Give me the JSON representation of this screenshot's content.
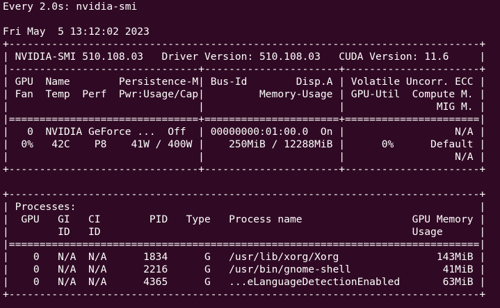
{
  "terminal": {
    "background": "#300a24",
    "foreground": "#ffffff",
    "lines": [
      "Every 2.0s: nvidia-smi",
      "",
      "Fri May  5 13:12:02 2023",
      "+-----------------------------------------------------------------------------+",
      "| NVIDIA-SMI 510.108.03   Driver Version: 510.108.03   CUDA Version: 11.6     |",
      "|-------------------------------+----------------------+----------------------+",
      "| GPU  Name        Persistence-M| Bus-Id        Disp.A | Volatile Uncorr. ECC |",
      "| Fan  Temp  Perf  Pwr:Usage/Cap|         Memory-Usage | GPU-Util  Compute M. |",
      "|                               |                      |               MIG M. |",
      "|===============================+======================+======================|",
      "|   0  NVIDIA GeForce ...  Off  | 00000000:01:00.0  On |                  N/A |",
      "|  0%   42C    P8    41W / 400W |    250MiB / 12288MiB |      0%      Default |",
      "|                               |                      |                  N/A |",
      "+-------------------------------+----------------------+----------------------+",
      "",
      "+-----------------------------------------------------------------------------+",
      "| Processes:                                                                  |",
      "|  GPU   GI   CI        PID   Type   Process name                  GPU Memory |",
      "|        ID   ID                                                   Usage      |",
      "|=============================================================================|",
      "|    0   N/A  N/A      1834      G   /usr/lib/xorg/Xorg                143MiB |",
      "|    0   N/A  N/A      2216      G   /usr/bin/gnome-shell               41MiB |",
      "|    0   N/A  N/A      4365      G   ...eLanguageDetectionEnabled       63MiB |",
      "+-----------------------------------------------------------------------------+"
    ]
  }
}
